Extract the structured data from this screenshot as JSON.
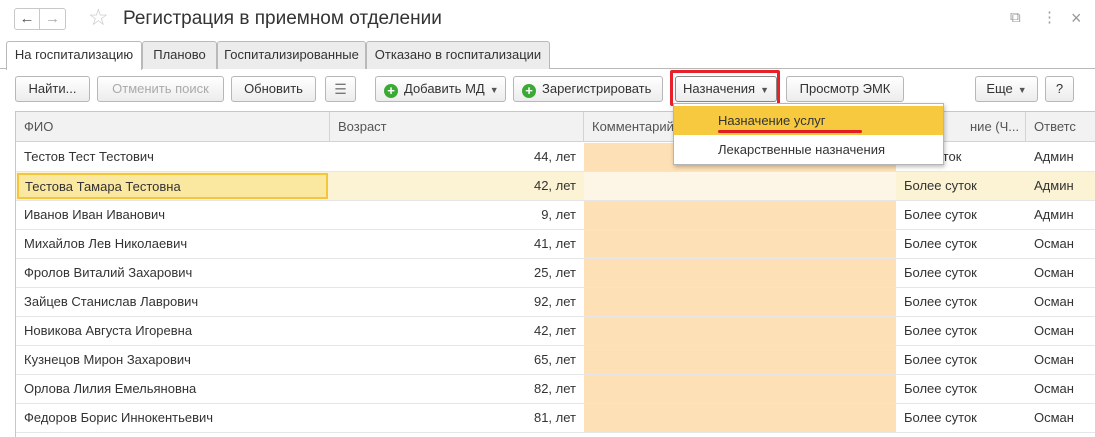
{
  "window": {
    "title": "Регистрация в приемном отделении",
    "back_icon": "←",
    "forward_icon": "→",
    "favorite_icon": "☆",
    "link_icon": "⧉",
    "more_icon": "⋮",
    "close_icon": "×"
  },
  "tabs": [
    {
      "label": "На госпитализацию",
      "active": true
    },
    {
      "label": "Планово",
      "active": false
    },
    {
      "label": "Госпитализированные",
      "active": false
    },
    {
      "label": "Отказано в госпитализации",
      "active": false
    }
  ],
  "toolbar": {
    "find": "Найти...",
    "cancel_search": "Отменить поиск",
    "refresh": "Обновить",
    "report_icon": "☰",
    "add_md": "Добавить МД",
    "register": "Зарегистрировать",
    "assignments": "Назначения",
    "view_emk": "Просмотр ЭМК",
    "more": "Еще",
    "help": "?"
  },
  "dropdown": {
    "items": [
      "Назначение услуг",
      "Лекарственные назначения"
    ]
  },
  "table": {
    "columns": [
      "ФИО",
      "Возраст",
      "Комментарий",
      "ние (Ч...",
      "Ответс"
    ],
    "sort_icon": "↑",
    "rows": [
      {
        "fio": "Тестов Тест Тестович",
        "age": "44, лет",
        "comment": "",
        "duration": "лее суток",
        "resp": "Админ"
      },
      {
        "fio": "Тестова Тамара Тестовна",
        "age": "42, лет",
        "comment": "",
        "duration": "Более суток",
        "resp": "Админ"
      },
      {
        "fio": "Иванов Иван Иванович",
        "age": "9, лет",
        "comment": "",
        "duration": "Более суток",
        "resp": "Админ"
      },
      {
        "fio": "Михайлов Лев Николаевич",
        "age": "41, лет",
        "comment": "",
        "duration": "Более суток",
        "resp": "Осман"
      },
      {
        "fio": "Фролов Виталий Захарович",
        "age": "25, лет",
        "comment": "",
        "duration": "Более суток",
        "resp": "Осман"
      },
      {
        "fio": "Зайцев Станислав Лаврович",
        "age": "92, лет",
        "comment": "",
        "duration": "Более суток",
        "resp": "Осман"
      },
      {
        "fio": "Новикова Августа Игоревна",
        "age": "42, лет",
        "comment": "",
        "duration": "Более суток",
        "resp": "Осман"
      },
      {
        "fio": "Кузнецов Мирон Захарович",
        "age": "65, лет",
        "comment": "",
        "duration": "Более суток",
        "resp": "Осман"
      },
      {
        "fio": "Орлова Лилия Емельяновна",
        "age": "82, лет",
        "comment": "",
        "duration": "Более суток",
        "resp": "Осман"
      },
      {
        "fio": "Федоров Борис Иннокентьевич",
        "age": "81, лет",
        "comment": "",
        "duration": "Более суток",
        "resp": "Осман"
      }
    ],
    "selected_row": 1
  },
  "colors": {
    "highlight_frame": "#e8202a",
    "dropdown_highlight": "#f6c93f",
    "comment_cell": "#fde0b5",
    "add_icon": "#3aaa35"
  }
}
